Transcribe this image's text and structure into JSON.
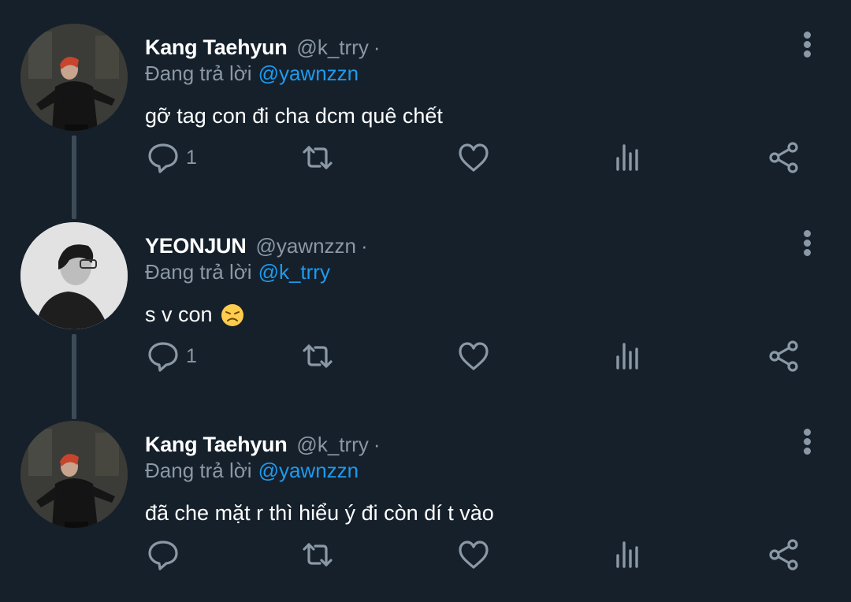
{
  "tweets": [
    {
      "name": "Kang Taehyun",
      "handle": "@k_trry",
      "separator": "·",
      "replying_prefix": "Đang trả lời",
      "replying_to": "@yawnzzn",
      "text": "gỡ tag con đi cha dcm quê chết",
      "reply_count": "1",
      "avatar": "kang"
    },
    {
      "name": "YEONJUN",
      "handle": "@yawnzzn",
      "separator": "·",
      "replying_prefix": "Đang trả lời",
      "replying_to": "@k_trry",
      "text": "s v con",
      "reply_count": "1",
      "avatar": "yeon",
      "emoji": "disappointed-face-emoji"
    },
    {
      "name": "Kang Taehyun",
      "handle": "@k_trry",
      "separator": "·",
      "replying_prefix": "Đang trả lời",
      "replying_to": "@yawnzzn",
      "text": "đã che mặt r thì hiểu ý đi còn dí t vào",
      "reply_count": "",
      "avatar": "kang"
    }
  ],
  "icons": {
    "reply": "reply-bubble-icon",
    "retweet": "retweet-icon",
    "like": "heart-icon",
    "analytics": "analytics-bars-icon",
    "share": "share-icon",
    "more": "more-vertical-icon"
  },
  "colors": {
    "background": "#15202b",
    "text": "#ffffff",
    "secondary": "#8b98a5",
    "link": "#1d9bf0",
    "thread_line": "#3d4b58"
  }
}
